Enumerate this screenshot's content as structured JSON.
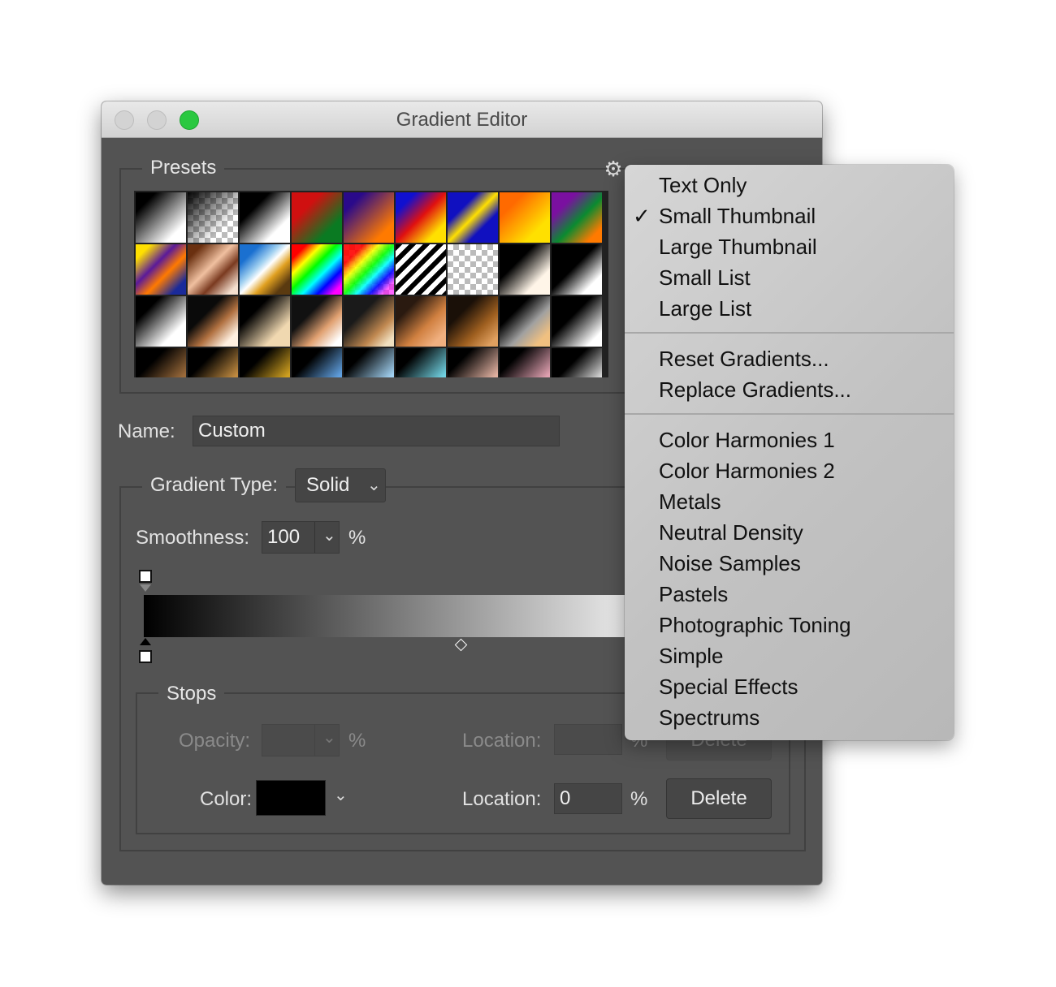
{
  "window": {
    "title": "Gradient Editor"
  },
  "presets": {
    "label": "Presets",
    "gear_icon": "gear-icon",
    "swatches": [
      "linear-gradient(135deg,#000 20%,#fff 80%)",
      "linear-gradient(135deg,#000 0%,rgba(0,0,0,0) 70%),repeating-conic-gradient(#bbb 0% 25%,#fff 0% 50%) 0 0/14px 14px",
      "linear-gradient(135deg,#000 30%,#fff 75%)",
      "linear-gradient(135deg,#d01010 30%,#0a7a22 75%)",
      "linear-gradient(135deg,#2a0a8a 20%,#ff7a00 80%)",
      "linear-gradient(135deg,#1010d0 20%,#e01010 50%,#ffe000 80%)",
      "linear-gradient(135deg,#1010c0 30%,#ffe000 50%,#1010c0 70%)",
      "linear-gradient(135deg,#ff6a00 25%,#ffe000 75%)",
      "linear-gradient(135deg,#7a10a0 25%,#0a8a30 55%,#ff7a00 85%)",
      "linear-gradient(135deg,#ffe000 15%,#5a1a9a 40%,#ff7a00 60%,#1a2a9a 85%)",
      "linear-gradient(135deg,#6a3010 15%,#f0c0a0 45%,#7a3a20 65%,#f5e0d0 90%)",
      "linear-gradient(135deg,#1a70d0 20%,#a0d0f0 40%,#fff 50%,#e0a020 65%,#5a3a10 85%)",
      "linear-gradient(135deg,#f00 15%,#ff0 30%,#0f0 45%,#0ff 60%,#00f 75%,#f0f 90%)",
      "linear-gradient(135deg,rgba(255,0,0,0.9) 20%,rgba(255,255,0,0.9) 35%,rgba(0,255,0,0.9) 50%,rgba(0,255,255,0.9) 62%,rgba(0,0,255,0.9) 75%,rgba(255,0,255,0.6) 88%),repeating-conic-gradient(#bbb 0% 25%,#fff 0% 50%) 0 0/14px 14px",
      "repeating-linear-gradient(135deg,#000 0 6px,#fff 6px 12px)",
      "repeating-conic-gradient(#bbb 0% 25%,#fff 0% 50%) 0 0/14px 14px",
      "linear-gradient(135deg,#000 35%,#fff5e8 75%)",
      "linear-gradient(135deg,#000 45%,#fff 80%)",
      "linear-gradient(135deg,#000 25%,#fff 75%)",
      "linear-gradient(135deg,#0a0a0a 35%,#b07040 60%,#fff0e0 85%)",
      "linear-gradient(135deg,#000 30%,#f0d8b0 75%)",
      "linear-gradient(135deg,#111 35%,#e0a070 65%,#fff 90%)",
      "linear-gradient(135deg,#1a1a1a 35%,#c08850 70%,#f0e0c0 90%)",
      "linear-gradient(135deg,#2a1a10 25%,#d08040 60%,#f0b080 85%)",
      "linear-gradient(135deg,#1a1008 30%,#a06020 65%,#e0a060 90%)",
      "linear-gradient(135deg,#000 30%,#a0a0a0 60%,#f0c080 85%)",
      "linear-gradient(135deg,#000 40%,#fff 85%)",
      "linear-gradient(135deg,#000 30%,#9a6a3a 75%)",
      "linear-gradient(135deg,#000 30%,#c08a40 75%)",
      "linear-gradient(135deg,#000 30%,#d0a020 75%)",
      "linear-gradient(135deg,#000 30%,#60a0e0 75%)",
      "linear-gradient(135deg,#000 25%,#a0d0f0 75%)",
      "linear-gradient(135deg,#000 25%,#70d0e0 75%)",
      "linear-gradient(135deg,#000 25%,#e0b0a0 75%)",
      "linear-gradient(135deg,#000 25%,#e0a0b0 75%)",
      "linear-gradient(135deg,#000 35%,#ffffff 85%)"
    ]
  },
  "name_field": {
    "label": "Name:",
    "value": "Custom"
  },
  "gradient_type": {
    "label": "Gradient Type:",
    "value": "Solid"
  },
  "smoothness": {
    "label": "Smoothness:",
    "value": "100",
    "unit": "%"
  },
  "gradient": {
    "start_color": "#000000",
    "end_color": "#ffffff"
  },
  "stops": {
    "label": "Stops",
    "opacity_label": "Opacity:",
    "opacity_unit": "%",
    "opacity_location_label": "Location:",
    "opacity_location_unit": "%",
    "opacity_delete": "Delete",
    "color_label": "Color:",
    "color_value": "#000000",
    "color_location_label": "Location:",
    "color_location_value": "0",
    "color_location_unit": "%",
    "color_delete": "Delete"
  },
  "menu": {
    "checkmark": "✓",
    "view_items": [
      "Text Only",
      "Small Thumbnail",
      "Large Thumbnail",
      "Small List",
      "Large List"
    ],
    "checked_index": 1,
    "reset_items": [
      "Reset Gradients...",
      "Replace Gradients..."
    ],
    "library_items": [
      "Color Harmonies 1",
      "Color Harmonies 2",
      "Metals",
      "Neutral Density",
      "Noise Samples",
      "Pastels",
      "Photographic Toning",
      "Simple",
      "Special Effects",
      "Spectrums"
    ]
  }
}
